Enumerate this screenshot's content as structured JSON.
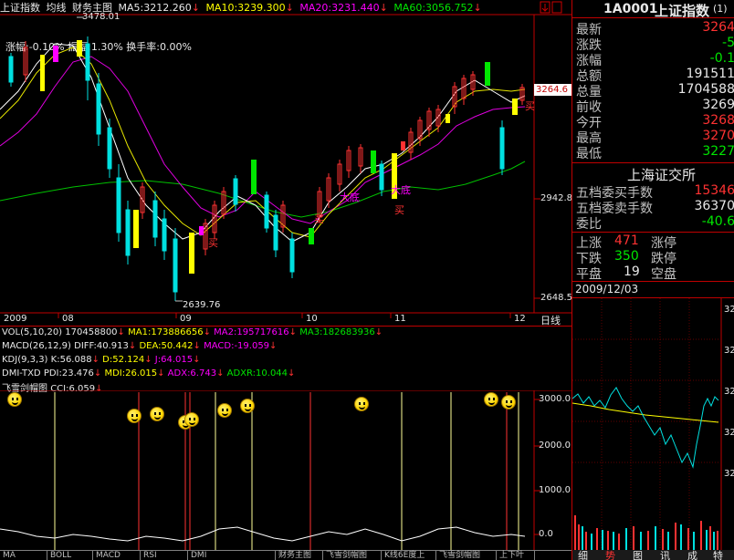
{
  "main_header": {
    "title": "上证指数",
    "view": "均线",
    "tab": "财务主图",
    "ma5": "MA5:3212.260",
    "ma10": "MA10:3239.300",
    "ma20": "MA20:3231.440",
    "ma60": "MA60:3056.752",
    "info": "涨幅:-0.10%",
    "amp": "振幅:1.30%",
    "turnover": "换手率:0.00%"
  },
  "price_labels": {
    "high": "3478.01",
    "low": "2639.76",
    "current": "3264.6",
    "p1": "2942.8",
    "p2": "2648.5"
  },
  "time_axis": {
    "labels": [
      "2009",
      "08",
      "09",
      "10",
      "11",
      "12"
    ],
    "period": "日线"
  },
  "signals": {
    "buy": "买",
    "bottom": "大底"
  },
  "indicators": {
    "vol": "VOL(5,10,20)",
    "vol_val": "170458800",
    "vol_ma1": "MA1:173886656",
    "vol_ma2": "MA2:195717616",
    "vol_ma3": "MA3:182683936",
    "macd": "MACD(26,12,9)",
    "diff": "DIFF:40.913",
    "dea": "DEA:50.442",
    "macd_val": "MACD:-19.059",
    "kdj": "KDJ(9,3,3)",
    "k": "K:56.088",
    "d": "D:52.124",
    "j": "J:64.015",
    "dmi": "DMI-TXD",
    "pdi": "PDI:23.476",
    "mdi": "MDI:26.015",
    "adx": "ADX:6.743",
    "adxr": "ADXR:10.044",
    "fx": "飞雪剑帽图",
    "cci": "CCI:6.059"
  },
  "sub_axis": [
    "3000.0",
    "2000.0",
    "1000.0",
    "0.0"
  ],
  "tabs": [
    "MA",
    "BOLL",
    "MACD",
    "RSI",
    "DMI",
    "财务主图",
    "飞雪剑帽图",
    "K线6E度上",
    "飞雪剑帽图",
    "上下叶穴"
  ],
  "quote": {
    "code": "1A0001",
    "name": "上证指数",
    "suffix": "(1)",
    "rows": [
      {
        "label": "最新",
        "value": "3264"
      },
      {
        "label": "涨跌",
        "value": "-5"
      },
      {
        "label": "涨幅",
        "value": "-0.1"
      },
      {
        "label": "总额",
        "value": "191511"
      },
      {
        "label": "总量",
        "value": "1704588"
      },
      {
        "label": "前收",
        "value": "3269"
      },
      {
        "label": "今开",
        "value": "3268"
      },
      {
        "label": "最高",
        "value": "3270"
      },
      {
        "label": "最低",
        "value": "3227"
      }
    ],
    "exchange": "上海证交所",
    "bid_label": "五档委买手数",
    "bid_value": "15346",
    "ask_label": "五档委卖手数",
    "ask_value": "36370",
    "ratio_label": "委比",
    "ratio_value": "-40.6",
    "up_label": "上涨",
    "up_value": "471",
    "limit_up": "涨停",
    "down_label": "下跌",
    "down_value": "350",
    "limit_down": "跌停",
    "flat_label": "平盘",
    "flat_value": "19",
    "stop_label": "空盘",
    "date": "2009/12/03",
    "mini_axis": [
      "32",
      "32",
      "32",
      "32",
      "32"
    ],
    "bottom_tabs": [
      "细",
      "势",
      "图",
      "讯",
      "成",
      "特"
    ]
  },
  "colors": {
    "up": "#ff3232",
    "down": "#00e0e0",
    "ma5": "#ffffff",
    "ma10": "#ffff00",
    "ma20": "#ff00ff",
    "ma60": "#00e600"
  }
}
